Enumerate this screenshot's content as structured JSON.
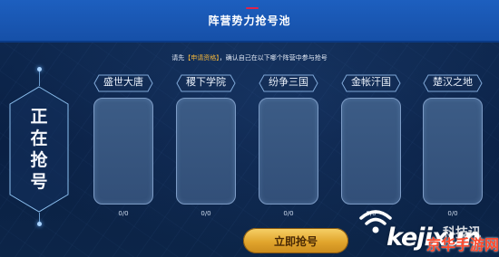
{
  "header": {
    "title": "阵营势力抢号池"
  },
  "hint": {
    "prefix": "请先",
    "highlight": "【申请资格】",
    "suffix": "，确认自己在以下哪个阵营中参与抢号"
  },
  "side": {
    "chars": [
      "正",
      "在",
      "抢",
      "号"
    ]
  },
  "factions": [
    {
      "name": "盛世大唐",
      "count": "0/0"
    },
    {
      "name": "稷下学院",
      "count": "0/0"
    },
    {
      "name": "纷争三国",
      "count": "0/0"
    },
    {
      "name": "金帐汗国",
      "count": "0/0"
    },
    {
      "name": "楚汉之地",
      "count": "0/0"
    }
  ],
  "actions": {
    "submit_label": "立即抢号"
  },
  "watermark": {
    "brand": "kejixun",
    "cn_overlay": "科技讯",
    "cn_red": "京华手游网"
  },
  "colors": {
    "header": "#1a58b5",
    "background": "#0c2346",
    "accent": "#f2b53a",
    "card": "#365580"
  }
}
